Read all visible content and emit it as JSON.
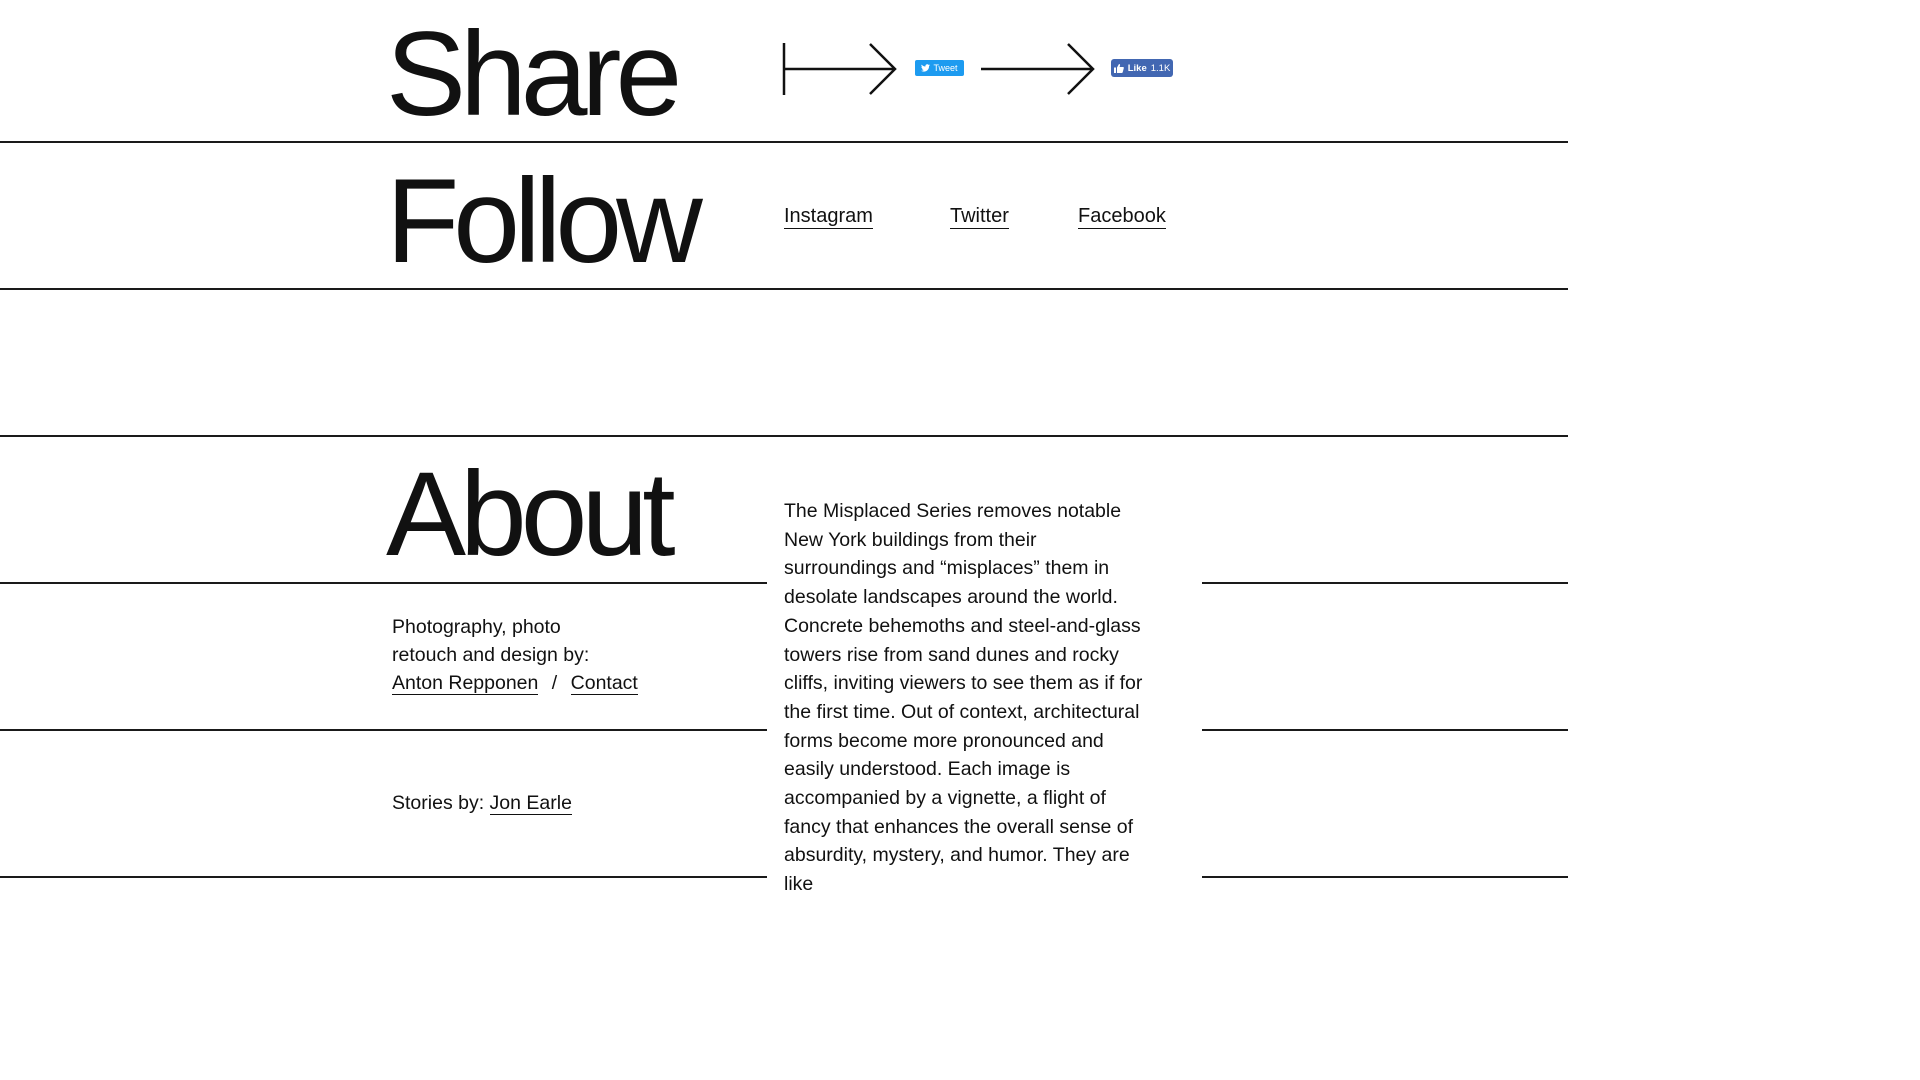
{
  "share": {
    "heading": "Share",
    "tweet_label": "Tweet",
    "like_label": "Like",
    "like_count": "1.1K"
  },
  "follow": {
    "heading": "Follow",
    "links": [
      "Instagram",
      "Twitter",
      "Facebook"
    ]
  },
  "about": {
    "heading": "About",
    "description": "The Misplaced Series removes notable New York buildings from their surroundings and “misplaces” them in desolate landscapes around the world. Concrete behemoths and steel-and-glass towers rise from sand dunes and rocky cliffs, inviting viewers to see them as if for the first time. Out of context, architectural forms become more pronounced and easily understood. Each image is accompanied by a vignette, a flight of fancy that enhances the overall sense of absurdity, mystery, and humor. They are like",
    "credits_line1": "Photography, photo",
    "credits_line2": "retouch and design by:",
    "credits_author": "Anton Repponen",
    "credits_separator": "/",
    "credits_contact": "Contact",
    "stories_label": "Stories by:",
    "stories_author": "Jon Earle"
  },
  "colors": {
    "text": "#111111",
    "tweet_blue": "#1d9bf0",
    "facebook_blue": "#4267b2"
  }
}
